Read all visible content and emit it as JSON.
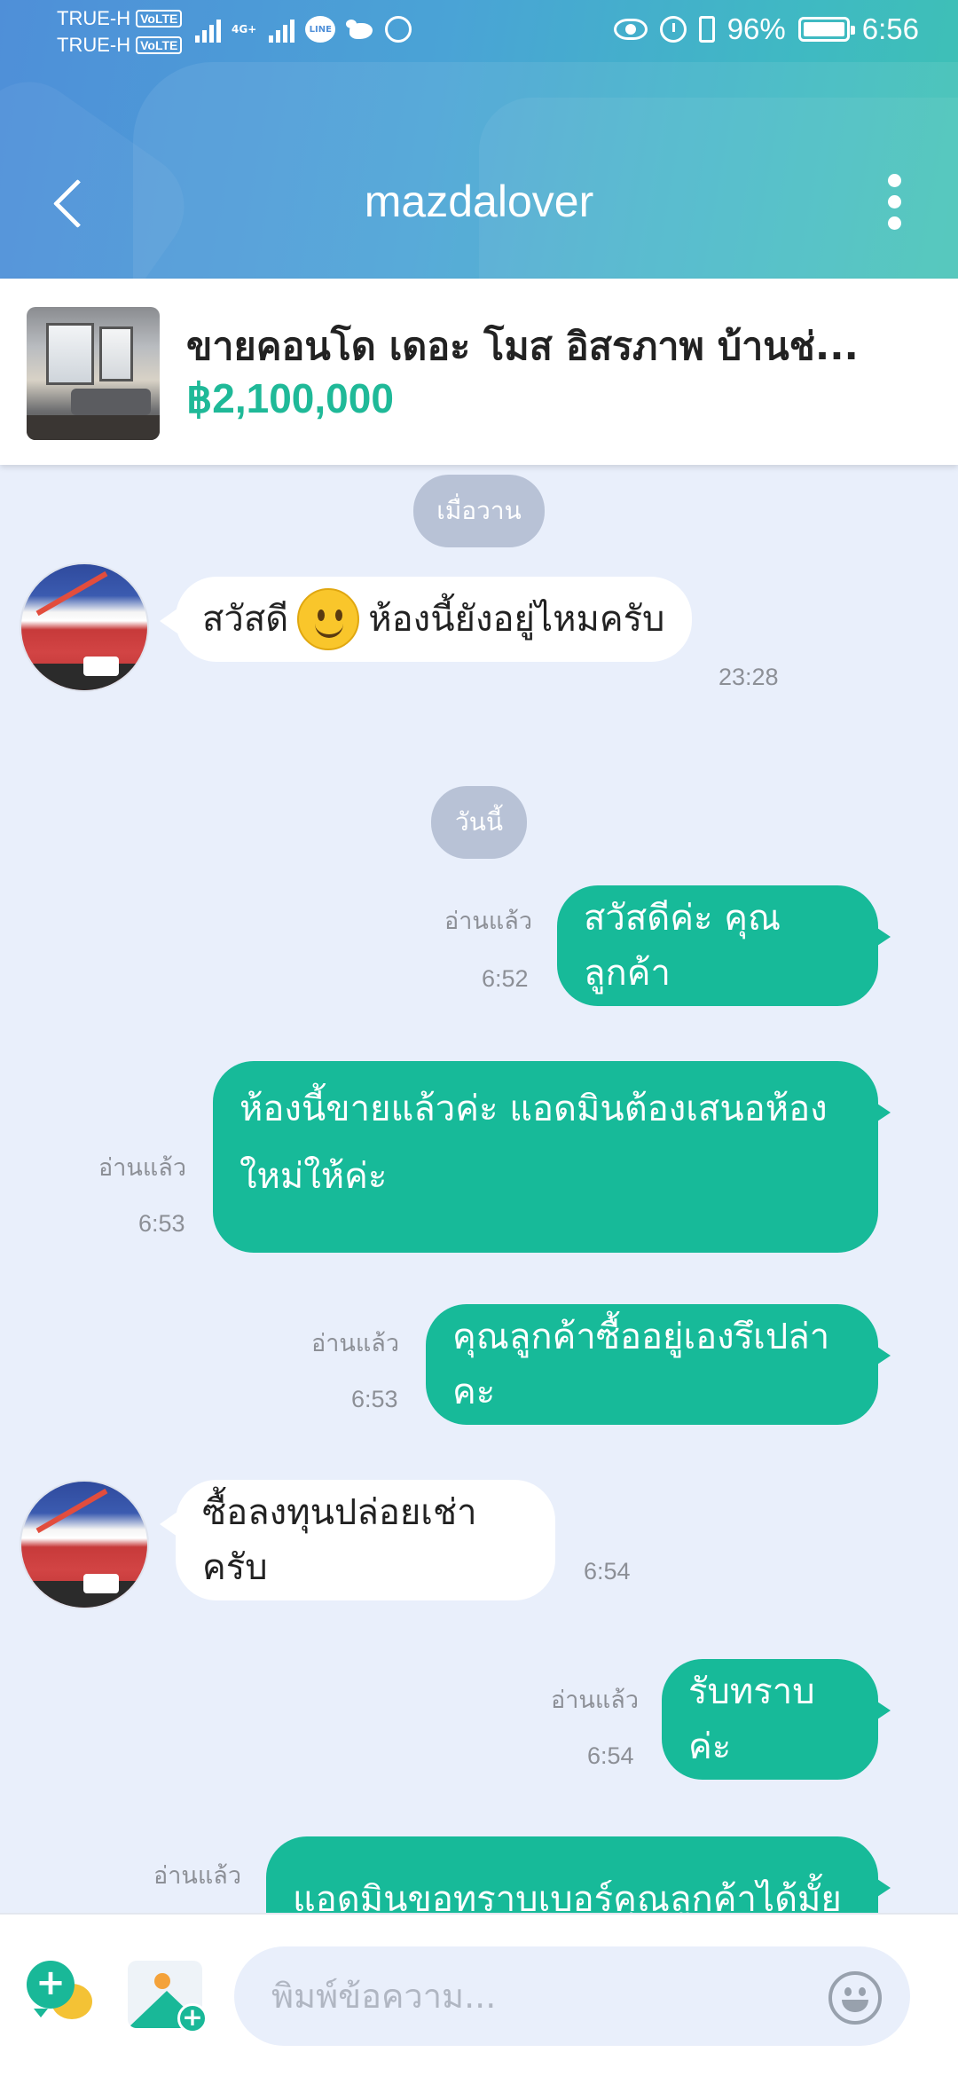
{
  "status_bar": {
    "carrier_1": "TRUE-H",
    "carrier_2": "TRUE-H",
    "volte": "VoLTE",
    "network": "4G+",
    "app_icons": [
      "line-icon",
      "twitter-icon",
      "whatsapp-icon"
    ],
    "battery": "96%",
    "time": "6:56"
  },
  "header": {
    "title": "mazdalover"
  },
  "listing": {
    "title": "ขายคอนโด  เดอะ โมส อิสรภาพ บ้านช่...",
    "price": "฿2,100,000"
  },
  "chat": {
    "date_yesterday": "เมื่อวาน",
    "date_today": "วันนี้",
    "messages": [
      {
        "dir": "in",
        "text_a": "สวัสดี",
        "text_b": "ห้องนี้ยังอยู่ไหมครับ",
        "time": "23:28"
      },
      {
        "dir": "out",
        "text": "สวัสดีค่ะ คุณลูกค้า",
        "read": "อ่านแล้ว",
        "time": "6:52"
      },
      {
        "dir": "out",
        "text_line1": "ห้องนี้ขายแล้วค่ะ แอดมินต้องเสนอห้อง",
        "text_line2": "ใหม่ให้ค่ะ",
        "read": "อ่านแล้ว",
        "time": "6:53"
      },
      {
        "dir": "out",
        "text": "คุณลูกค้าซื้ออยู่เองรึเปล่าคะ",
        "read": "อ่านแล้ว",
        "time": "6:53"
      },
      {
        "dir": "in",
        "text": "ซื้อลงทุนปล่อยเช่าครับ",
        "time": "6:54"
      },
      {
        "dir": "out",
        "text": "รับทราบค่ะ",
        "read": "อ่านแล้ว",
        "time": "6:54"
      },
      {
        "dir": "out",
        "text": "แอดมินขอทราบเบอร์คุณลูกค้าได้มั้ยคะ",
        "read": "อ่านแล้ว"
      }
    ]
  },
  "input": {
    "placeholder": "พิมพ์ข้อความ..."
  },
  "colors": {
    "accent_green": "#17ba99",
    "header_blue": "#4f8fd8",
    "chat_bg": "#e9effb"
  }
}
